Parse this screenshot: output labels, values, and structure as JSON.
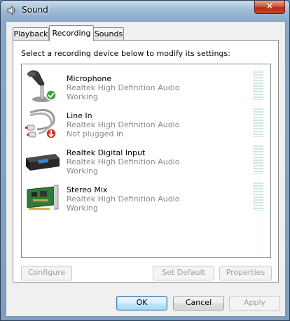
{
  "window": {
    "title": "Sound",
    "close_glyph": "✕"
  },
  "tabs": [
    {
      "label": "Playback",
      "active": false
    },
    {
      "label": "Recording",
      "active": true
    },
    {
      "label": "Sounds",
      "active": false
    }
  ],
  "instruction": "Select a recording device below to modify its settings:",
  "devices": [
    {
      "icon": "microphone-icon",
      "name": "Microphone",
      "description": "Realtek High Definition Audio",
      "status": "Working",
      "badge": "default-device-check"
    },
    {
      "icon": "line-in-icon",
      "name": "Line In",
      "description": "Realtek High Definition Audio",
      "status": "Not plugged in",
      "badge": "unplugged-arrow"
    },
    {
      "icon": "digital-input-icon",
      "name": "Realtek Digital Input",
      "description": "Realtek High Definition Audio",
      "status": "Working",
      "badge": ""
    },
    {
      "icon": "stereo-mix-icon",
      "name": "Stereo Mix",
      "description": "Realtek High Definition Audio",
      "status": "Working",
      "badge": ""
    }
  ],
  "panel_buttons": {
    "configure": {
      "label": "Configure",
      "enabled": false
    },
    "set_default": {
      "label": "Set Default",
      "enabled": false
    },
    "properties": {
      "label": "Properties",
      "enabled": false
    }
  },
  "dialog_buttons": {
    "ok": {
      "label": "OK",
      "enabled": true
    },
    "cancel": {
      "label": "Cancel",
      "enabled": true
    },
    "apply": {
      "label": "Apply",
      "enabled": false
    }
  },
  "colors": {
    "check_badge": "#3aa03a",
    "unplugged_badge": "#d03a2a",
    "meter": "#cfe9e2"
  }
}
